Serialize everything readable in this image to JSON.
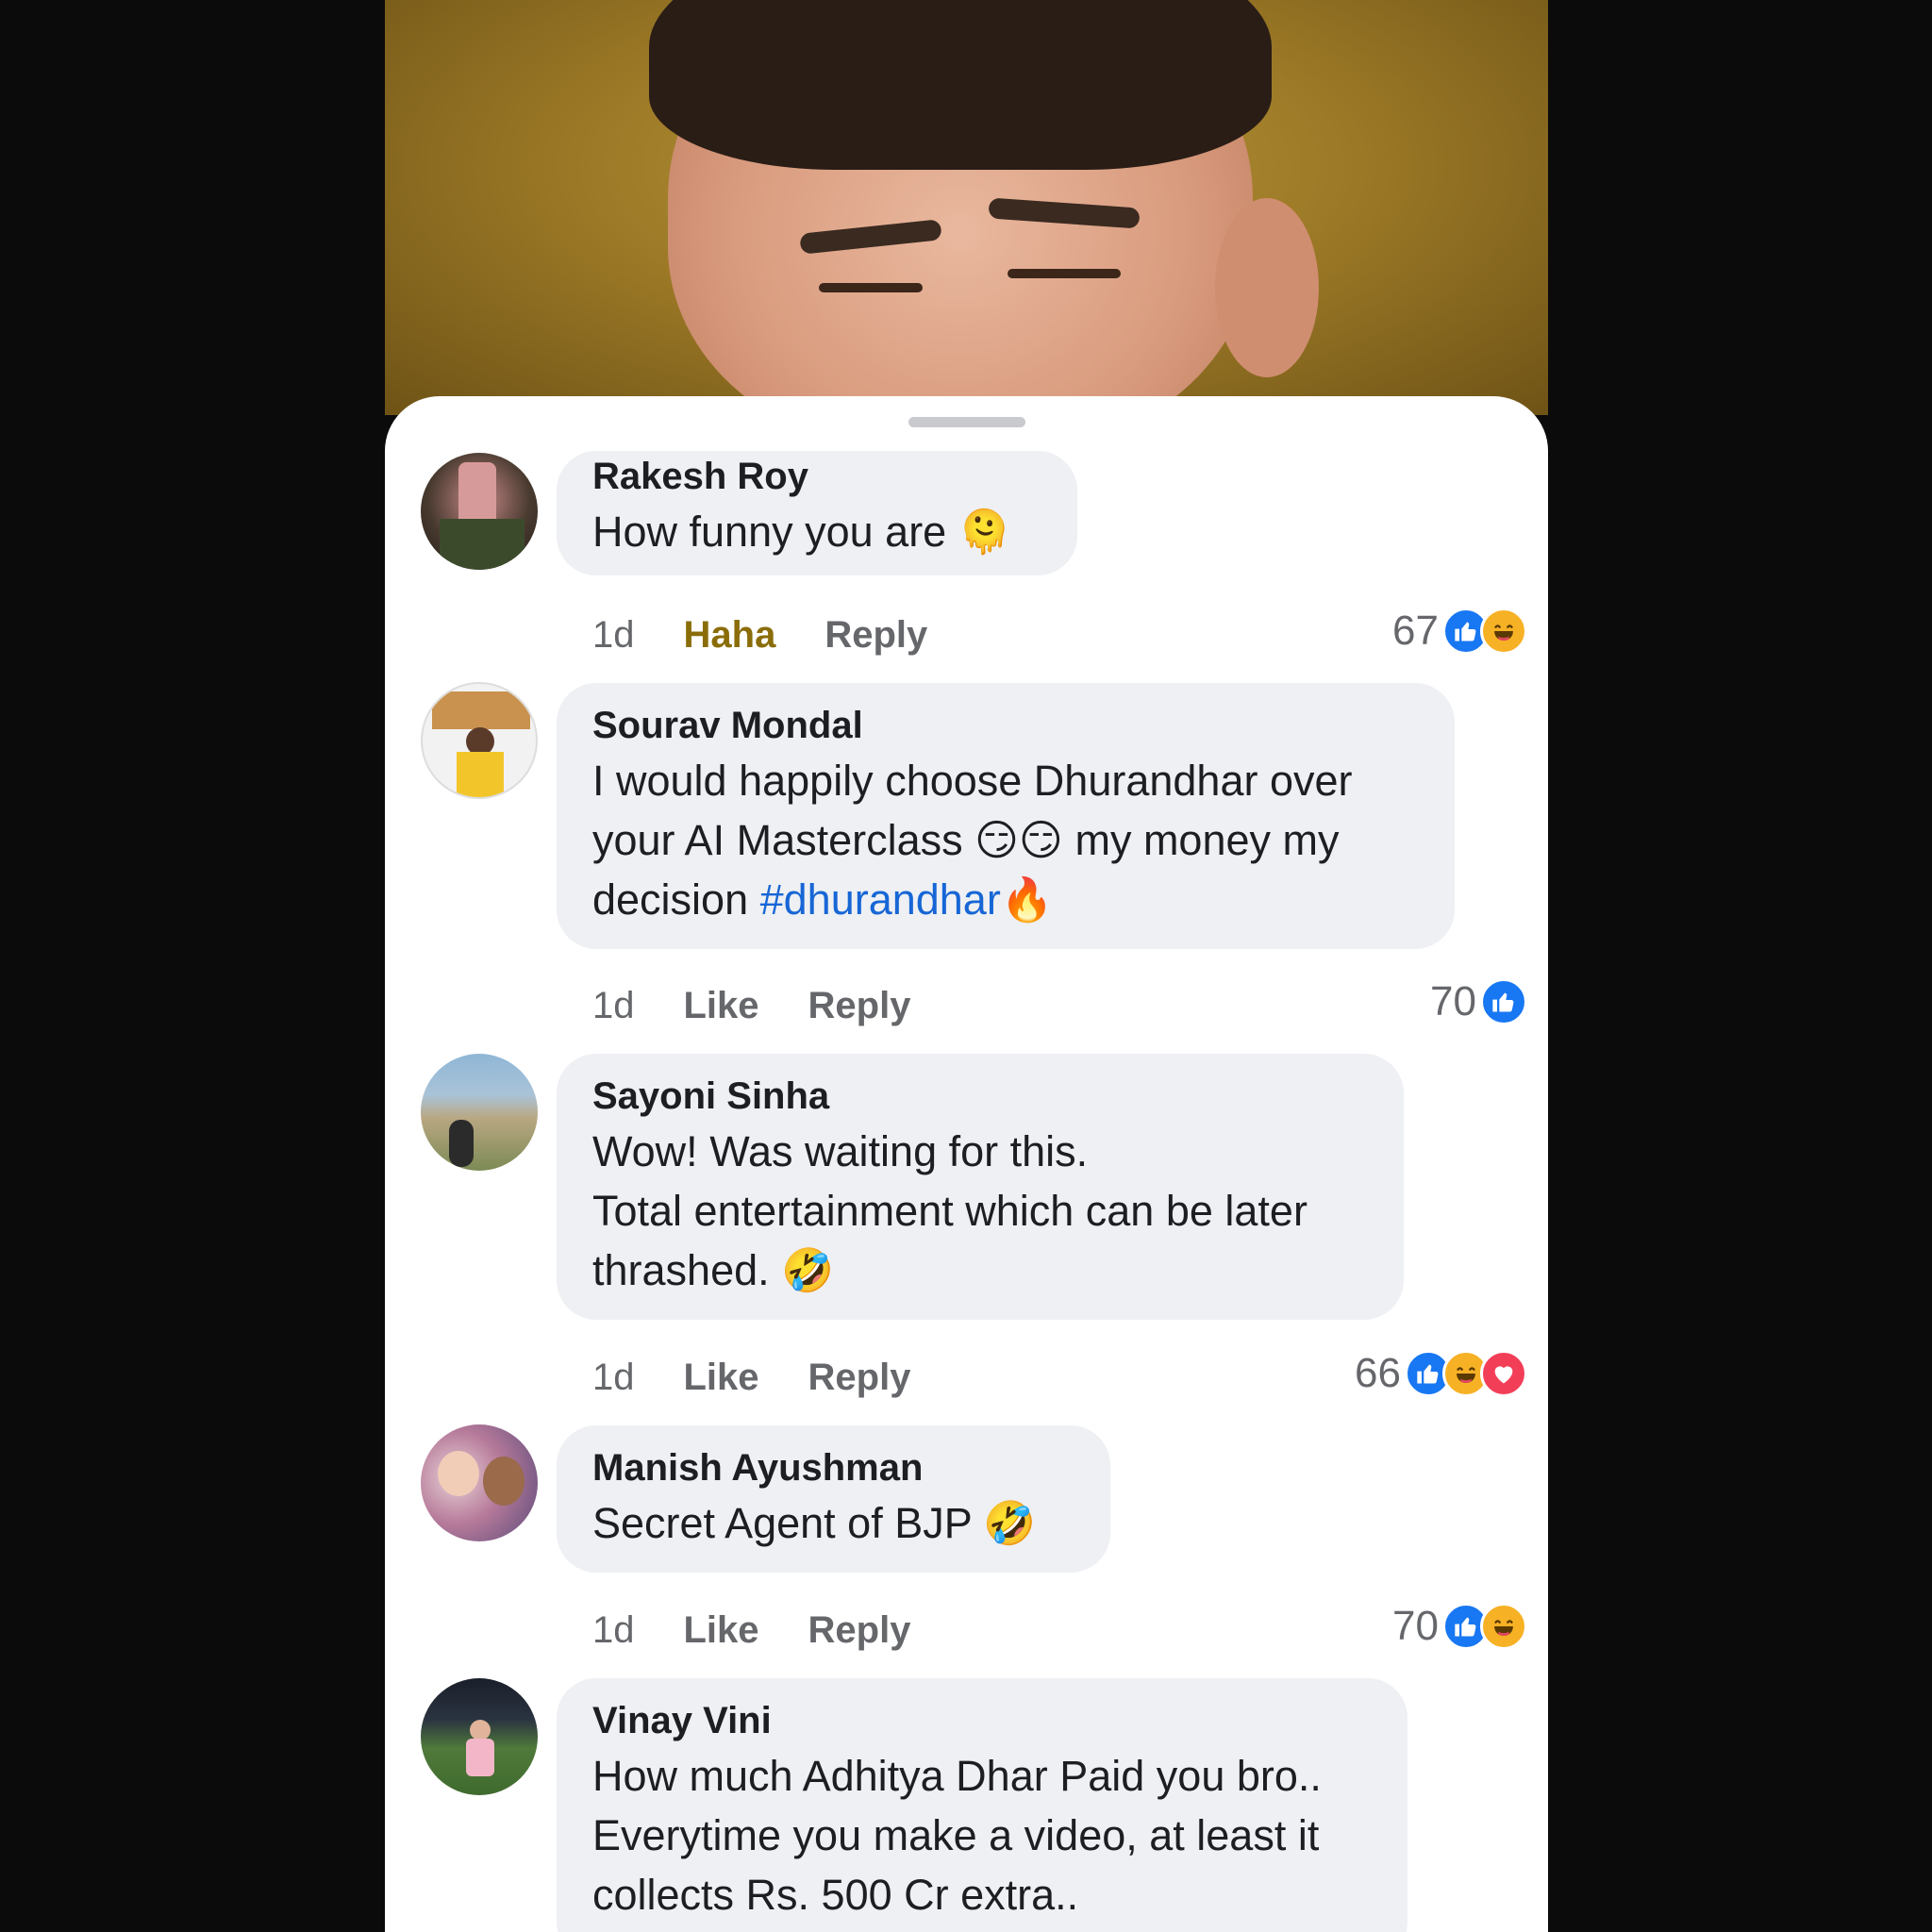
{
  "comments": [
    {
      "name": "Rakesh Roy",
      "text": "How funny you are 🫠",
      "time": "1d",
      "primary_action": "Haha",
      "reply": "Reply",
      "reaction_count": "67",
      "reactions": [
        "like",
        "haha"
      ]
    },
    {
      "name": "Sourav Mondal",
      "text_before": "I would happily choose Dhurandhar over\nyour AI Masterclass 😏😏 my money my\ndecision ",
      "hashtag": "#dhurandhar",
      "text_after": "🔥",
      "time": "1d",
      "primary_action": "Like",
      "reply": "Reply",
      "reaction_count": "70",
      "reactions": [
        "like"
      ]
    },
    {
      "name": "Sayoni Sinha",
      "text": "Wow! Was waiting for this.\nTotal entertainment which can be later\nthrashed.  🤣",
      "time": "1d",
      "primary_action": "Like",
      "reply": "Reply",
      "reaction_count": "66",
      "reactions": [
        "like",
        "haha",
        "love"
      ]
    },
    {
      "name": "Manish Ayushman",
      "text": "Secret Agent of BJP 🤣",
      "time": "1d",
      "primary_action": "Like",
      "reply": "Reply",
      "reaction_count": "70",
      "reactions": [
        "like",
        "haha"
      ]
    },
    {
      "name": "Vinay Vini",
      "text": "How much Adhitya Dhar Paid you bro..\nEverytime you make a video, at least it\ncollects Rs. 500 Cr extra.."
    }
  ],
  "colors": {
    "like": "#1877f2",
    "haha": "#f7b125",
    "love": "#f33e58",
    "hashtag": "#1766d6",
    "haha_action": "#8a6d09",
    "bubble": "#eef0f3"
  }
}
